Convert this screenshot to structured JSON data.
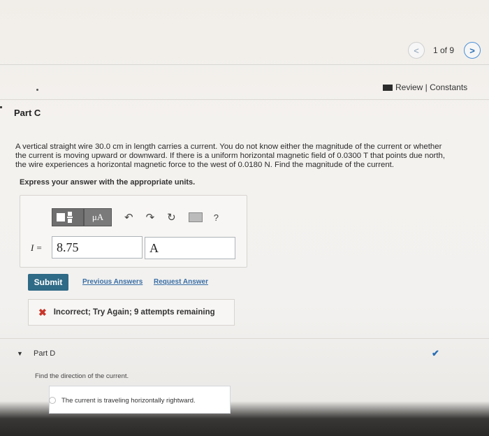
{
  "pager": {
    "text": "1 of 9",
    "prev_label": "<",
    "next_label": ">"
  },
  "header_links": {
    "review_constants": "Review | Constants"
  },
  "part_c": {
    "title": "Part C",
    "question_lines": [
      "A vertical straight wire 30.0 cm in length carries a current. You do not know either the magnitude of the current or whether",
      "the current is moving upward or downward. If there is a uniform horizontal magnetic field of 0.0300 T that points due north,",
      "the wire experiences a horizontal magnetic force to the west of 0.0180 N. Find the magnitude of the current."
    ],
    "instruction": "Express your answer with the appropriate units."
  },
  "toolbar": {
    "units_button": "μA",
    "help": "?"
  },
  "answer": {
    "variable": "I =",
    "value": "8.75",
    "unit": "A"
  },
  "actions": {
    "submit": "Submit",
    "previous_answers": "Previous Answers",
    "request_answer": "Request Answer"
  },
  "feedback": {
    "text": "Incorrect; Try Again; 9 attempts remaining"
  },
  "part_d": {
    "title": "Part D",
    "question": "Find the direction of the current.",
    "option": "The current is traveling horizontally rightward."
  },
  "colors": {
    "submit_bg": "#2f6a86",
    "link": "#3a6ea5",
    "error": "#c9352a",
    "accent": "#2a6fb5"
  }
}
